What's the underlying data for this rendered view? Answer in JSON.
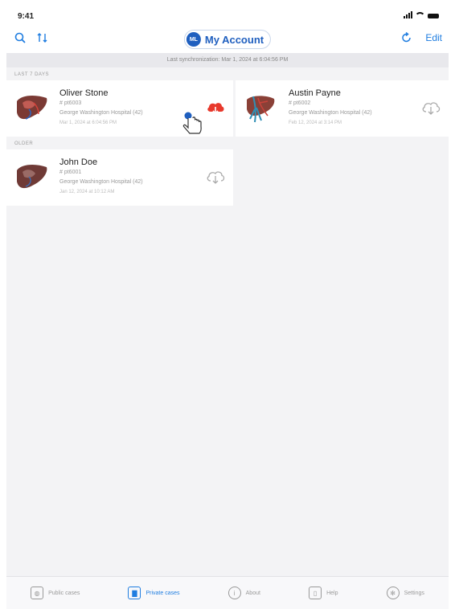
{
  "status_bar": {
    "time": "9:41"
  },
  "nav": {
    "account_label": "My Account",
    "avatar_initials": "ML",
    "edit_label": "Edit"
  },
  "sync": {
    "last_sync_text": "Last synchronization: Mar 1, 2024 at 6:04:56 PM"
  },
  "sections": {
    "last7": {
      "title": "LAST 7 DAYS",
      "cases": [
        {
          "name": "Oliver Stone",
          "case_id": "# pt6003",
          "hospital": "George Washington Hospital (42)",
          "date": "Mar 1, 2024 at 6:04:56 PM",
          "cloud_status": "downloading",
          "cloud_color": "#e8392c"
        },
        {
          "name": "Austin Payne",
          "case_id": "# pt6002",
          "hospital": "George Washington Hospital (42)",
          "date": "Feb 12, 2024 at 3:14 PM",
          "cloud_status": "download",
          "cloud_color": "#aaaaaa"
        }
      ]
    },
    "older": {
      "title": "OLDER",
      "cases": [
        {
          "name": "John Doe",
          "case_id": "# pt6001",
          "hospital": "George Washington Hospital (42)",
          "date": "Jan 12, 2024 at 10:12 AM",
          "cloud_status": "download",
          "cloud_color": "#aaaaaa"
        }
      ]
    }
  },
  "tabs": [
    {
      "label": "Public cases",
      "icon": "globe-icon",
      "active": false
    },
    {
      "label": "Private cases",
      "icon": "lock-icon",
      "active": true
    },
    {
      "label": "About",
      "icon": "info-icon",
      "active": false
    },
    {
      "label": "Help",
      "icon": "book-icon",
      "active": false
    },
    {
      "label": "Settings",
      "icon": "gear-icon",
      "active": false
    }
  ],
  "colors": {
    "accent": "#1f7de0",
    "account_blue": "#1f5fbf",
    "alert_red": "#e8392c"
  }
}
